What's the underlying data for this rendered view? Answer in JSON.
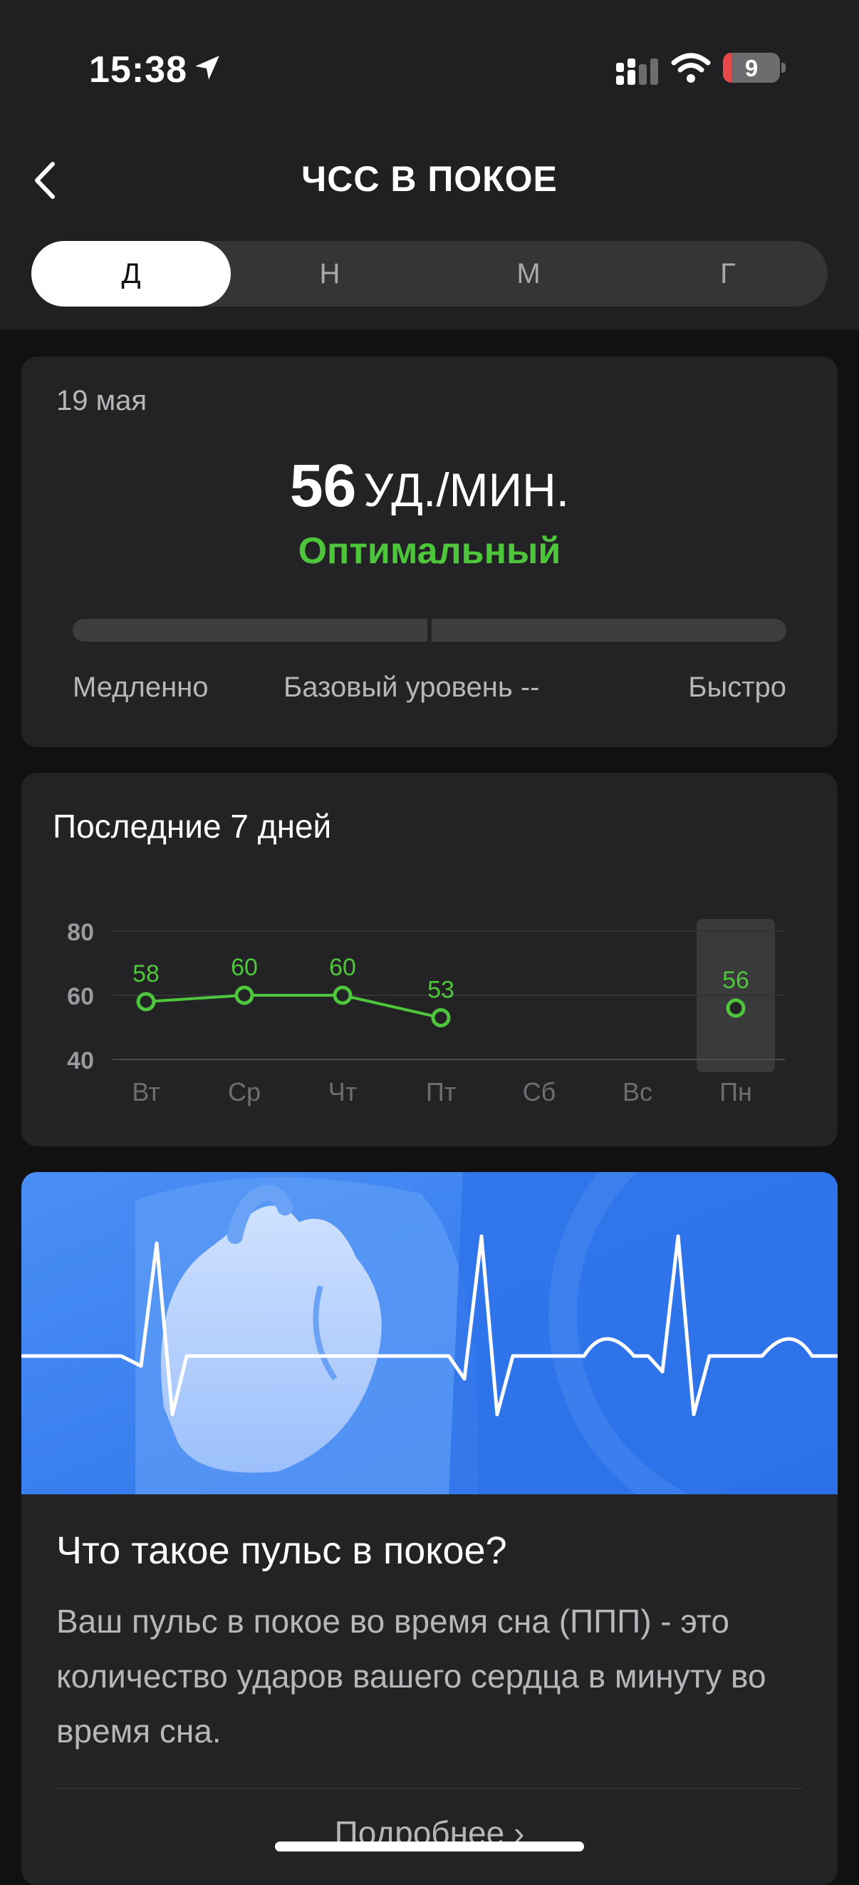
{
  "status_bar": {
    "time": "15:38",
    "battery": "9"
  },
  "header": {
    "title": "ЧСС В ПОКОЕ",
    "back_icon": "chevron-left-icon"
  },
  "period_tabs": [
    {
      "label": "Д",
      "active": true
    },
    {
      "label": "Н",
      "active": false
    },
    {
      "label": "М",
      "active": false
    },
    {
      "label": "Г",
      "active": false
    }
  ],
  "summary": {
    "date": "19 мая",
    "value": "56",
    "unit": "УД./МИН.",
    "status": "Оптимальный",
    "label_slow": "Медленно",
    "label_base": "Базовый уровень --",
    "label_fast": "Быстро"
  },
  "weekly": {
    "title": "Последние 7 дней"
  },
  "chart_data": {
    "type": "line",
    "categories": [
      "Вт",
      "Ср",
      "Чт",
      "Пт",
      "Сб",
      "Вс",
      "Пн"
    ],
    "values": [
      58,
      60,
      60,
      53,
      null,
      null,
      56
    ],
    "y_ticks": [
      "80",
      "60",
      "40"
    ],
    "ylim": [
      40,
      80
    ],
    "grid": true,
    "highlighted_category": "Пн",
    "series_color": "#4ec63b"
  },
  "info": {
    "title": "Что такое пульс в покое?",
    "body": "Ваш пульс в покое во время сна (ППП) - это количество ударов вашего сердца в минуту во время сна.",
    "more": "Подробнее"
  },
  "colors": {
    "accent": "#4ec63b",
    "background": "#111112",
    "card": "#232325",
    "banner": "#3b7ff2"
  }
}
